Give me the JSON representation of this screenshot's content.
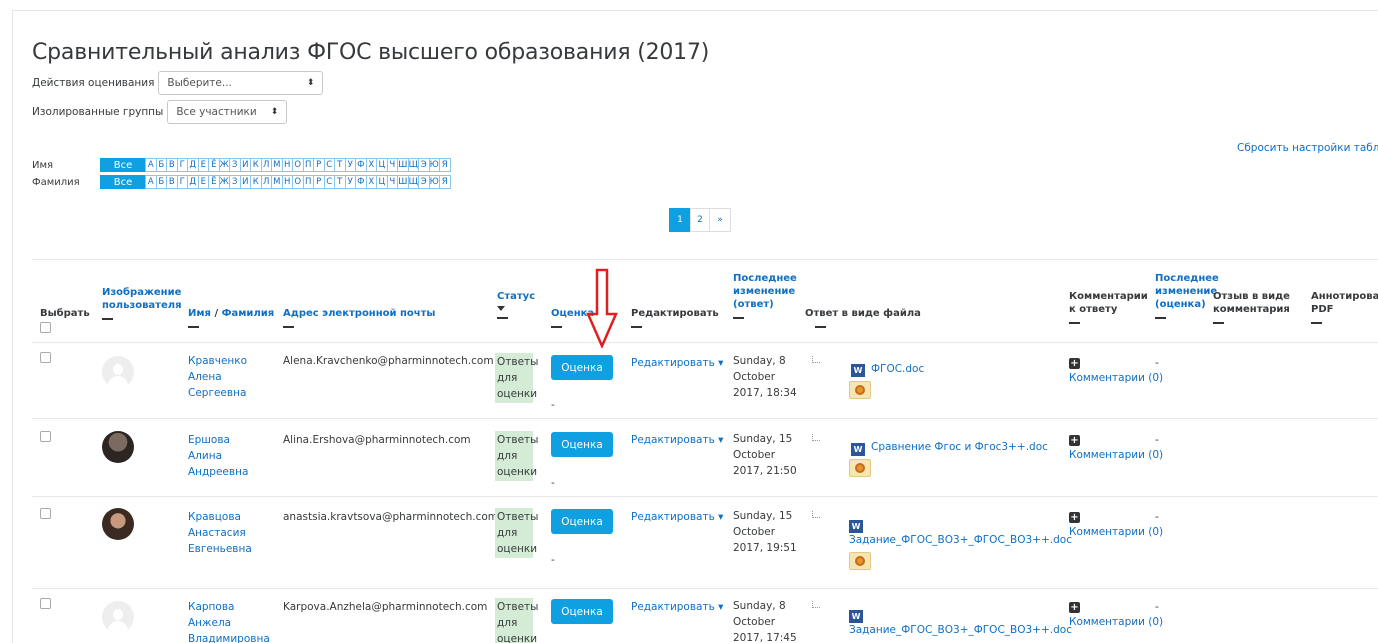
{
  "page": {
    "title": "Сравнительный анализ ФГОС высшего образования (2017)",
    "reset_link": "Сбросить настройки таблицы"
  },
  "filters": {
    "grading_actions_label": "Действия оценивания",
    "grading_actions_value": "Выберите...",
    "groups_label": "Изолированные группы",
    "groups_value": "Все участники"
  },
  "initials": {
    "first_label": "Имя",
    "last_label": "Фамилия",
    "all": "Все",
    "letters": [
      "А",
      "Б",
      "В",
      "Г",
      "Д",
      "Е",
      "Ё",
      "Ж",
      "З",
      "И",
      "К",
      "Л",
      "М",
      "Н",
      "О",
      "П",
      "Р",
      "С",
      "Т",
      "У",
      "Ф",
      "Х",
      "Ц",
      "Ч",
      "Ш",
      "Щ",
      "Э",
      "Ю",
      "Я"
    ]
  },
  "pagination": {
    "current": "1",
    "next_page": "2",
    "next_symbol": "»"
  },
  "columns": {
    "select": "Выбрать",
    "picture": "Изображение пользователя",
    "first_name": "Имя",
    "slash": " / ",
    "last_name": "Фамилия",
    "email": "Адрес электронной почты",
    "status": "Статус",
    "grade": "Оценка",
    "edit": "Редактировать",
    "last_modified_submission": "Последнее изменение (ответ)",
    "file_submissions": "Ответ в виде файла",
    "submission_comments": "Комментарии к ответу",
    "last_modified_grade": "Последнее изменение (оценка)",
    "feedback_comments": "Отзыв в виде комментария",
    "annotate_pdf": "Аннотировани PDF"
  },
  "rows": [
    {
      "name": "Кравченко Алена Сергеевна",
      "email": "Alena.Kravchenko@pharminnotech.com",
      "status": "Ответы для оценки",
      "grade_button": "Оценка",
      "grade_value": "-",
      "edit": "Редактировать ▾",
      "date": "Sunday, 8 October 2017, 18:34",
      "file": "ФГОС.doc",
      "comments": "Комментарии (0)",
      "grade_modified": "-"
    },
    {
      "name": "Ершова Алина Андреевна",
      "email": "Alina.Ershova@pharminnotech.com",
      "status": "Ответы для оценки",
      "grade_button": "Оценка",
      "grade_value": "-",
      "edit": "Редактировать ▾",
      "date": "Sunday, 15 October 2017, 21:50",
      "file": "Сравнение Фгос и Фгос3++.doc",
      "comments": "Комментарии (0)",
      "grade_modified": "-"
    },
    {
      "name": "Кравцова Анастасия Евгеньевна",
      "email": "anastsia.kravtsova@pharminnotech.com",
      "status": "Ответы для оценки",
      "grade_button": "Оценка",
      "grade_value": "-",
      "edit": "Редактировать ▾",
      "date": "Sunday, 15 October 2017, 19:51",
      "file": "Задание_ФГОС_ВО3+_ФГОС_ВО3++.doc",
      "comments": "Комментарии (0)",
      "grade_modified": "-"
    },
    {
      "name": "Карпова Анжела Владимировна",
      "email": "Karpova.Anzhela@pharminnotech.com",
      "status": "Ответы для оценки",
      "grade_button": "Оценка",
      "grade_value": "-",
      "edit": "Редактировать ▾",
      "date": "Sunday, 8 October 2017, 17:45",
      "file": "Задание_ФГОС_ВО3+_ФГОС_ВО3++.doc",
      "comments": "Комментарии (0)",
      "grade_modified": "-"
    }
  ],
  "icons": {
    "word": "W",
    "plus": "+",
    "dropdown": "⬍"
  },
  "colors": {
    "accent": "#0ea0e0",
    "link": "#0f6fc5",
    "status_bg": "#d4ecd5",
    "annotation_arrow": "#e02020"
  }
}
